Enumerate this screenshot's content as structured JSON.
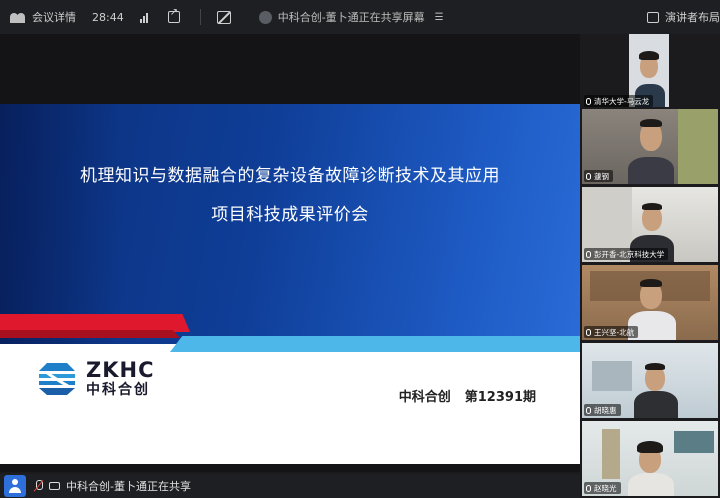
{
  "topbar": {
    "meeting_details": "会议详情",
    "timer": "28:44",
    "sharer_status": "中科合创-董卜通正在共享屏幕",
    "view_layout": "演讲者布局"
  },
  "slide": {
    "title_line1": "机理知识与数据融合的复杂设备故障诊断技术及其应用",
    "title_line2": "项目科技成果评价会",
    "logo_en": "ZKHC",
    "logo_cn": "中科合创",
    "footer_org": "中科合创",
    "footer_issue": "第12391期",
    "colors": {
      "band": "#0f3e98",
      "red": "#e0182d",
      "cyan": "#4db7ea"
    }
  },
  "participants": [
    {
      "name": "清华大学-马云龙"
    },
    {
      "name": "蘧钢"
    },
    {
      "name": "彭开香-北京科技大学"
    },
    {
      "name": "王兴坚-北航"
    },
    {
      "name": "胡晓惠"
    },
    {
      "name": "赵晓光"
    }
  ],
  "bottombar": {
    "status": "中科合创-董卜通正在共享"
  }
}
